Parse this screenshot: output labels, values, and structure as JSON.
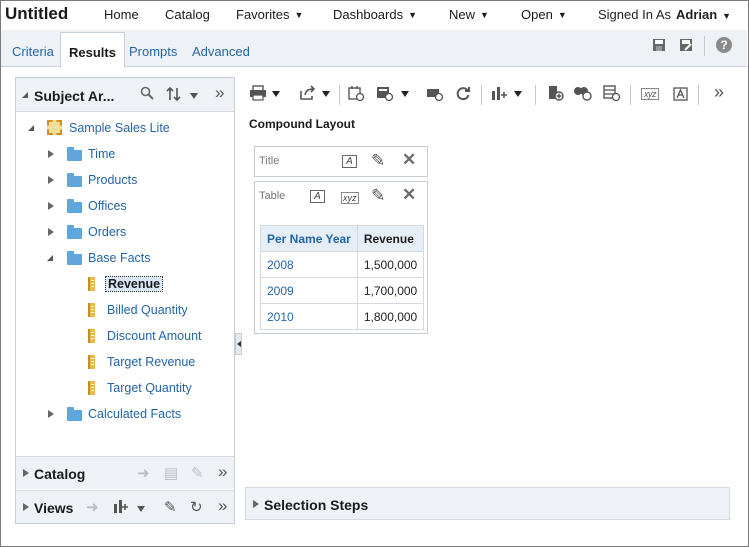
{
  "app": {
    "title": "Untitled"
  },
  "header": {
    "nav": [
      {
        "label": "Home",
        "dropdown": false
      },
      {
        "label": "Catalog",
        "dropdown": false
      },
      {
        "label": "Favorites",
        "dropdown": true
      },
      {
        "label": "Dashboards",
        "dropdown": true
      },
      {
        "label": "New",
        "dropdown": true
      },
      {
        "label": "Open",
        "dropdown": true
      }
    ],
    "signed_in_label": "Signed In As",
    "user": "Adrian"
  },
  "tabs": [
    {
      "label": "Criteria",
      "active": false
    },
    {
      "label": "Results",
      "active": true
    },
    {
      "label": "Prompts",
      "active": false
    },
    {
      "label": "Advanced",
      "active": false
    }
  ],
  "tab_actions": [
    "save-icon",
    "save-as-icon",
    "help-icon"
  ],
  "subject_area": {
    "title": "Subject Ar...",
    "tree": {
      "root": "Sample Sales Lite",
      "folders": [
        "Time",
        "Products",
        "Offices",
        "Orders"
      ],
      "base_facts": {
        "label": "Base Facts",
        "measures": [
          "Revenue",
          "Billed Quantity",
          "Discount Amount",
          "Target Revenue",
          "Target Quantity"
        ],
        "selected": "Revenue"
      },
      "calculated": "Calculated Facts"
    }
  },
  "accordions": {
    "catalog": "Catalog",
    "views": "Views"
  },
  "compound_layout": {
    "title": "Compound Layout",
    "title_view": {
      "label": "Title"
    },
    "table_view": {
      "label": "Table"
    },
    "table": {
      "headers": [
        "Per Name Year",
        "Revenue"
      ],
      "rows": [
        [
          "2008",
          "1,500,000"
        ],
        [
          "2009",
          "1,700,000"
        ],
        [
          "2010",
          "1,800,000"
        ]
      ]
    }
  },
  "selection_steps": {
    "title": "Selection Steps"
  },
  "colors": {
    "link": "#2465a7",
    "folder": "#5ea6de",
    "measure": "#e9b84f",
    "header_bg": "#eef2f6"
  }
}
